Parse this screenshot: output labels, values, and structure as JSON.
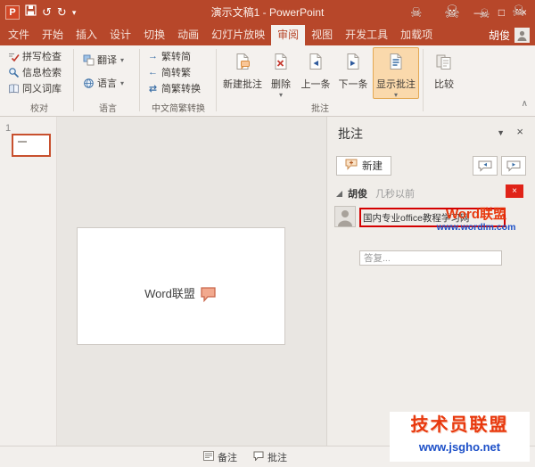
{
  "theme": {
    "accent": "#B7472A",
    "ribbon_bg": "#F4F1EE",
    "highlight": "#FAD9AC",
    "annotation_red": "#D40000",
    "link_blue": "#1D50C8",
    "watermark_red": "#E8380D"
  },
  "titlebar": {
    "title": "演示文稿1 - PowerPoint"
  },
  "icons": {
    "pp_letter": "P",
    "undo": "↺",
    "redo": "↻",
    "dropdown": "▾",
    "minimize": "—",
    "maximize": "□",
    "close": "×",
    "skull": "☠",
    "collapse_ribbon": "∧",
    "panel_dropdown": "▼",
    "arrow_right": "→",
    "arrow_left": "←",
    "arrows_swap": "⇄"
  },
  "tabs": {
    "file": "文件",
    "home": "开始",
    "insert": "插入",
    "design": "设计",
    "transitions": "切换",
    "animations": "动画",
    "slideshow": "幻灯片放映",
    "review": "审阅",
    "view": "视图",
    "developer": "开发工具",
    "addins": "加载项"
  },
  "account": {
    "user": "胡俊"
  },
  "ribbon": {
    "proofing": {
      "label": "校对",
      "spell": "拼写检查",
      "research": "信息检索",
      "thesaurus": "同义词库"
    },
    "language": {
      "label": "语言",
      "translate": "翻译",
      "language": "语言"
    },
    "chinese": {
      "label": "中文简繁转换",
      "t2s": "繁转简",
      "s2t": "简转繁",
      "convert": "简繁转换"
    },
    "comments": {
      "label": "批注",
      "new": "新建批注",
      "delete": "删除",
      "previous": "上一条",
      "next": "下一条",
      "show": "显示批注"
    },
    "compare": {
      "label": "比较"
    }
  },
  "thumbnails": {
    "slide_number": "1"
  },
  "slide": {
    "text": "Word联盟"
  },
  "comments_panel": {
    "title": "批注",
    "new_button": "新建",
    "comment": {
      "author": "胡俊",
      "time": "几秒以前",
      "text": "国内专业office教程学习网",
      "reply_placeholder": "答复..."
    }
  },
  "statusbar": {
    "notes": "备注",
    "comments": "批注"
  },
  "watermarks": {
    "inline_title": "Word联盟",
    "inline_url": "www.wordlm.com",
    "corner_title": "技术员联盟",
    "corner_url": "www.jsgho.net"
  }
}
